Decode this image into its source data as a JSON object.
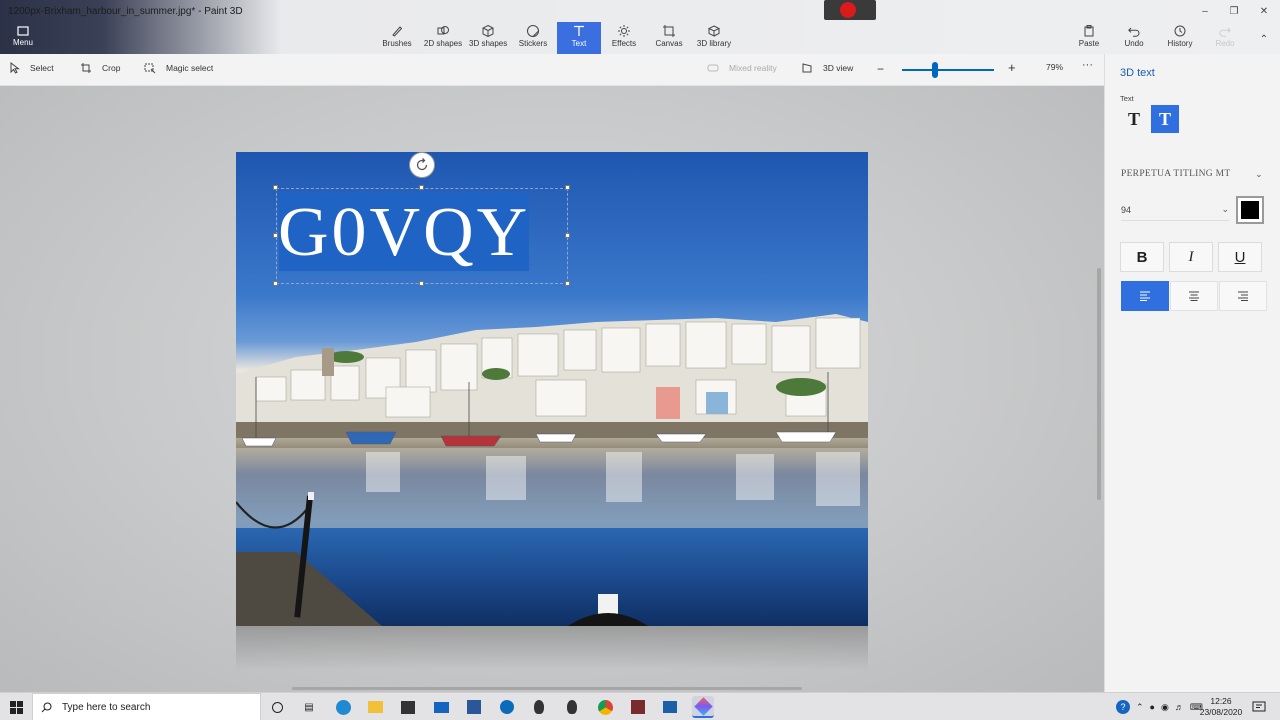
{
  "window": {
    "title": "1200px-Brixham_harbour_in_summer.jpg* - Paint 3D"
  },
  "menu": {
    "label": "Menu"
  },
  "tools": [
    {
      "id": "brushes",
      "label": "Brushes"
    },
    {
      "id": "2d-shapes",
      "label": "2D shapes"
    },
    {
      "id": "3d-shapes",
      "label": "3D shapes"
    },
    {
      "id": "stickers",
      "label": "Stickers"
    },
    {
      "id": "text",
      "label": "Text",
      "active": true
    },
    {
      "id": "effects",
      "label": "Effects"
    },
    {
      "id": "canvas",
      "label": "Canvas"
    },
    {
      "id": "3d-library",
      "label": "3D library"
    }
  ],
  "actions": {
    "paste": "Paste",
    "undo": "Undo",
    "history": "History",
    "redo": "Redo"
  },
  "subbar": {
    "select": "Select",
    "crop": "Crop",
    "magic_select": "Magic select",
    "mixed_reality": "Mixed reality",
    "view_3d": "3D view",
    "zoom": "79%",
    "zoom_fraction": 0.36
  },
  "canvas": {
    "text": "G0VQY"
  },
  "panel": {
    "title": "3D text",
    "section": "Text",
    "font": "PERPETUA TITLING MT",
    "size": "94",
    "color": "#000000",
    "bold": "B",
    "italic": "I",
    "underline": "U"
  },
  "taskbar": {
    "search_placeholder": "Type here to search",
    "time": "12:26",
    "date": "23/08/2020"
  },
  "colors": {
    "accent": "#3b6fe0",
    "text_fill": "#1f63c5",
    "record": "#d91b1b"
  }
}
